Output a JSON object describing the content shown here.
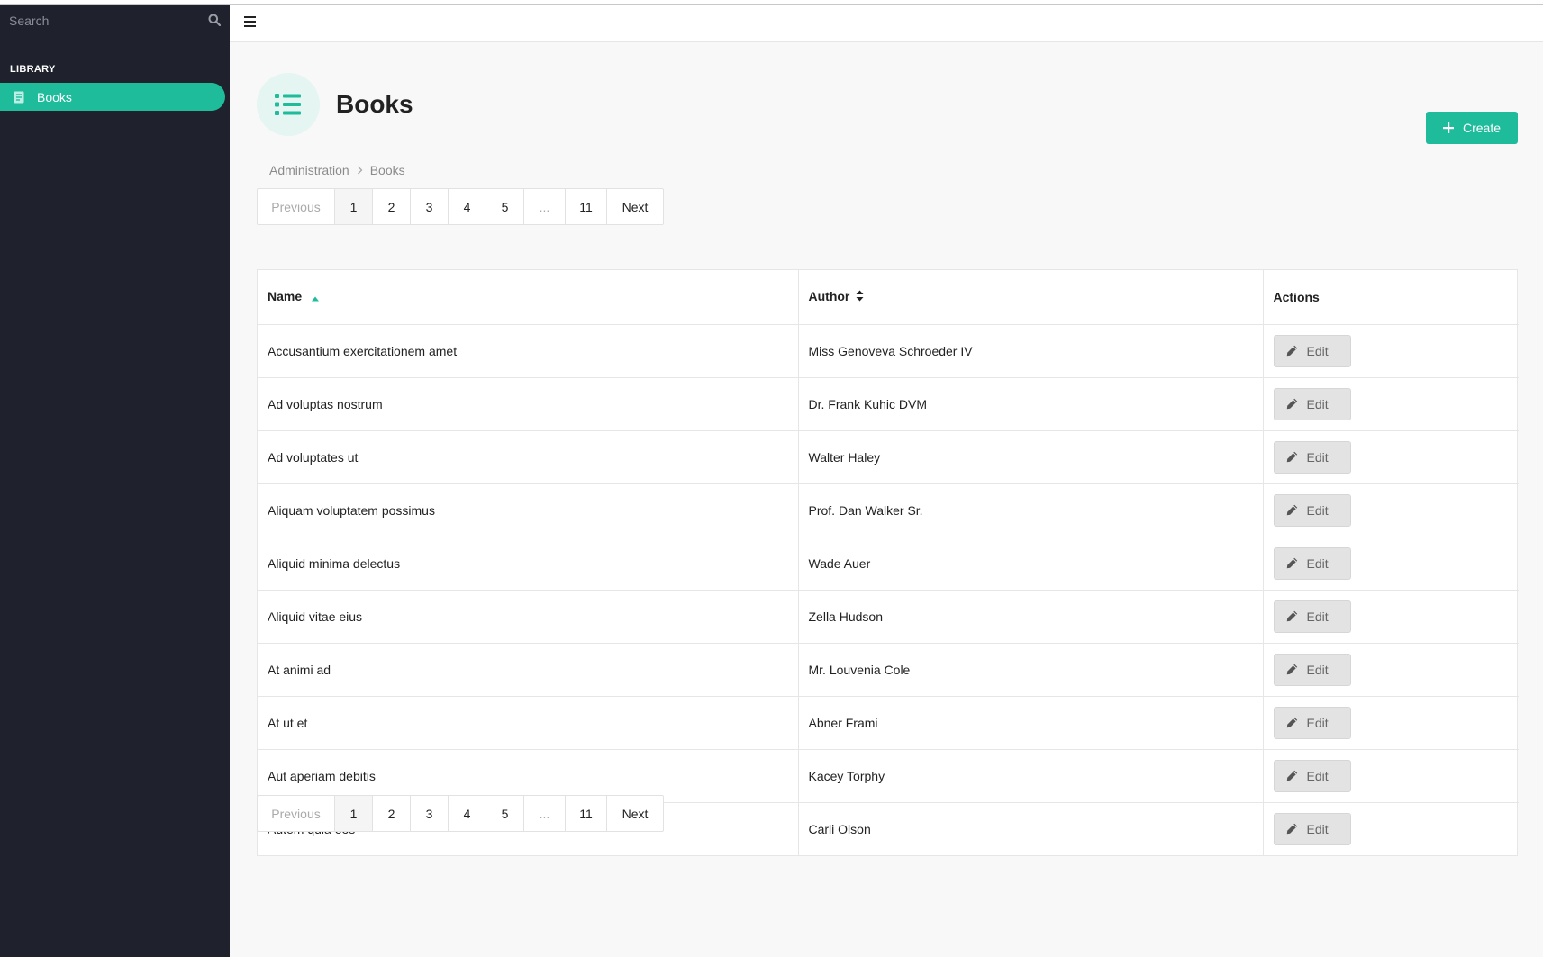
{
  "sidebar": {
    "search_placeholder": "Search",
    "section_label": "LIBRARY",
    "items": [
      {
        "label": "Books",
        "icon": "book-icon",
        "active": true
      }
    ]
  },
  "page": {
    "title": "Books",
    "title_icon": "list-icon",
    "create_label": "Create",
    "breadcrumb": [
      "Administration",
      "Books"
    ]
  },
  "pagination": {
    "previous": "Previous",
    "pages": [
      "1",
      "2",
      "3",
      "4",
      "5",
      "...",
      "11"
    ],
    "current": "1",
    "next": "Next"
  },
  "table": {
    "columns": [
      {
        "label": "Name",
        "sort": "ascending"
      },
      {
        "label": "Author",
        "sort": "sortable"
      },
      {
        "label": "Actions"
      }
    ],
    "edit_label": "Edit",
    "rows": [
      {
        "name": "Accusantium exercitationem amet",
        "author": "Miss Genoveva Schroeder IV"
      },
      {
        "name": "Ad voluptas nostrum",
        "author": "Dr. Frank Kuhic DVM"
      },
      {
        "name": "Ad voluptates ut",
        "author": "Walter Haley"
      },
      {
        "name": "Aliquam voluptatem possimus",
        "author": "Prof. Dan Walker Sr."
      },
      {
        "name": "Aliquid minima delectus",
        "author": "Wade Auer"
      },
      {
        "name": "Aliquid vitae eius",
        "author": "Zella Hudson"
      },
      {
        "name": "At animi ad",
        "author": "Mr. Louvenia Cole"
      },
      {
        "name": "At ut et",
        "author": "Abner Frami"
      },
      {
        "name": "Aut aperiam debitis",
        "author": "Kacey Torphy"
      },
      {
        "name": "Autem quia eos",
        "author": "Carli Olson"
      }
    ]
  },
  "colors": {
    "accent": "#1fbc9c",
    "sidebar_bg": "#1f222d",
    "page_bg": "#f8f8f8"
  }
}
